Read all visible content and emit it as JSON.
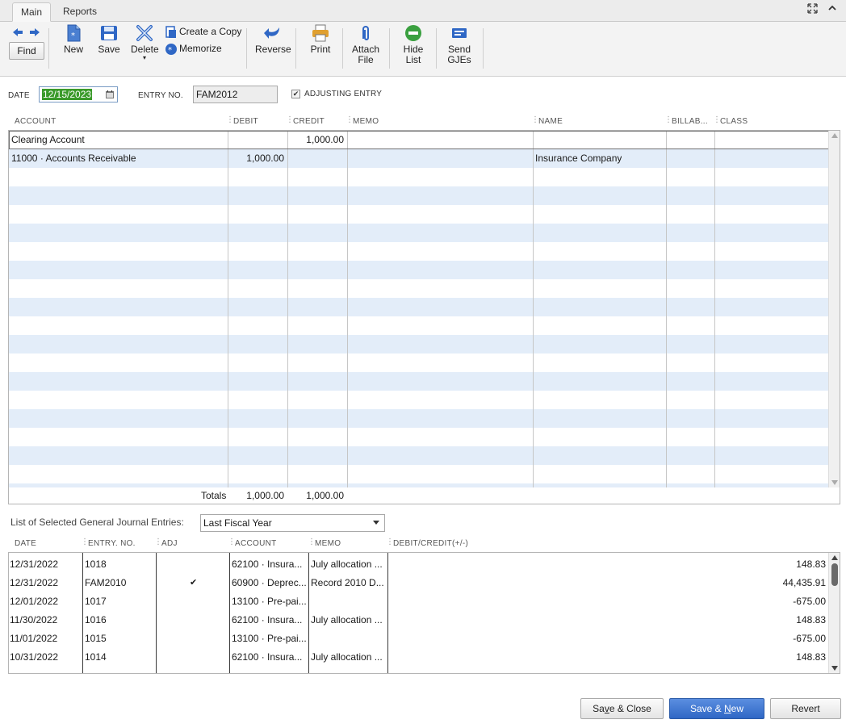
{
  "tabs": [
    {
      "label": "Main",
      "active": true
    },
    {
      "label": "Reports",
      "active": false
    }
  ],
  "window_controls": [
    "expand-icon",
    "collapse-icon"
  ],
  "toolbar": {
    "find": "Find",
    "new": "New",
    "save": "Save",
    "delete": "Delete",
    "create_copy": "Create a Copy",
    "memorize": "Memorize",
    "reverse": "Reverse",
    "print": "Print",
    "attach_1": "Attach",
    "attach_2": "File",
    "hide_1": "Hide",
    "hide_2": "List",
    "send_1": "Send",
    "send_2": "GJEs"
  },
  "header": {
    "date_label": "DATE",
    "date_value": "12/15/2023",
    "entry_label": "ENTRY NO.",
    "entry_value": "FAM2012",
    "adjusting_label": "ADJUSTING ENTRY",
    "adjusting_checked": true
  },
  "grid": {
    "columns": [
      "ACCOUNT",
      "DEBIT",
      "CREDIT",
      "MEMO",
      "NAME",
      "BILLAB...",
      "CLASS"
    ],
    "rows": [
      {
        "account": "Clearing Account",
        "debit": "",
        "credit": "1,000.00",
        "memo": "",
        "name": "",
        "billable": "",
        "class": ""
      },
      {
        "account": "11000 · Accounts Receivable",
        "debit": "1,000.00",
        "credit": "",
        "memo": "",
        "name": "Insurance Company",
        "billable": "",
        "class": ""
      }
    ],
    "totals_label": "Totals",
    "total_debit": "1,000.00",
    "total_credit": "1,000.00"
  },
  "entries_list": {
    "label": "List of Selected General Journal Entries:",
    "filter": "Last Fiscal Year",
    "columns": [
      "DATE",
      "ENTRY. NO.",
      "ADJ",
      "ACCOUNT",
      "MEMO",
      "DEBIT/CREDIT(+/-)"
    ],
    "rows": [
      {
        "date": "12/31/2022",
        "entry": "1018",
        "adj": "",
        "account": "62100 · Insura...",
        "memo": "July allocation ...",
        "amount": "148.83"
      },
      {
        "date": "12/31/2022",
        "entry": "FAM2010",
        "adj": "✔",
        "account": "60900 · Deprec...",
        "memo": "Record 2010 D...",
        "amount": "44,435.91"
      },
      {
        "date": "12/01/2022",
        "entry": "1017",
        "adj": "",
        "account": "13100 · Pre-pai...",
        "memo": "",
        "amount": "-675.00"
      },
      {
        "date": "11/30/2022",
        "entry": "1016",
        "adj": "",
        "account": "62100 · Insura...",
        "memo": "July allocation ...",
        "amount": "148.83"
      },
      {
        "date": "11/01/2022",
        "entry": "1015",
        "adj": "",
        "account": "13100 · Pre-pai...",
        "memo": "",
        "amount": "-675.00"
      },
      {
        "date": "10/31/2022",
        "entry": "1014",
        "adj": "",
        "account": "62100 · Insura...",
        "memo": "July allocation ...",
        "amount": "148.83"
      }
    ]
  },
  "buttons": {
    "save_close_u": "v",
    "save_close_pre": "Sa",
    "save_close_post": "e & Close",
    "save_new_pre": "Save & ",
    "save_new_u": "N",
    "save_new_post": "ew",
    "revert": "Revert"
  },
  "colors": {
    "accent": "#2f67c5",
    "row_alt": "#e3edf9",
    "date_highlight": "#3a9a2a"
  }
}
